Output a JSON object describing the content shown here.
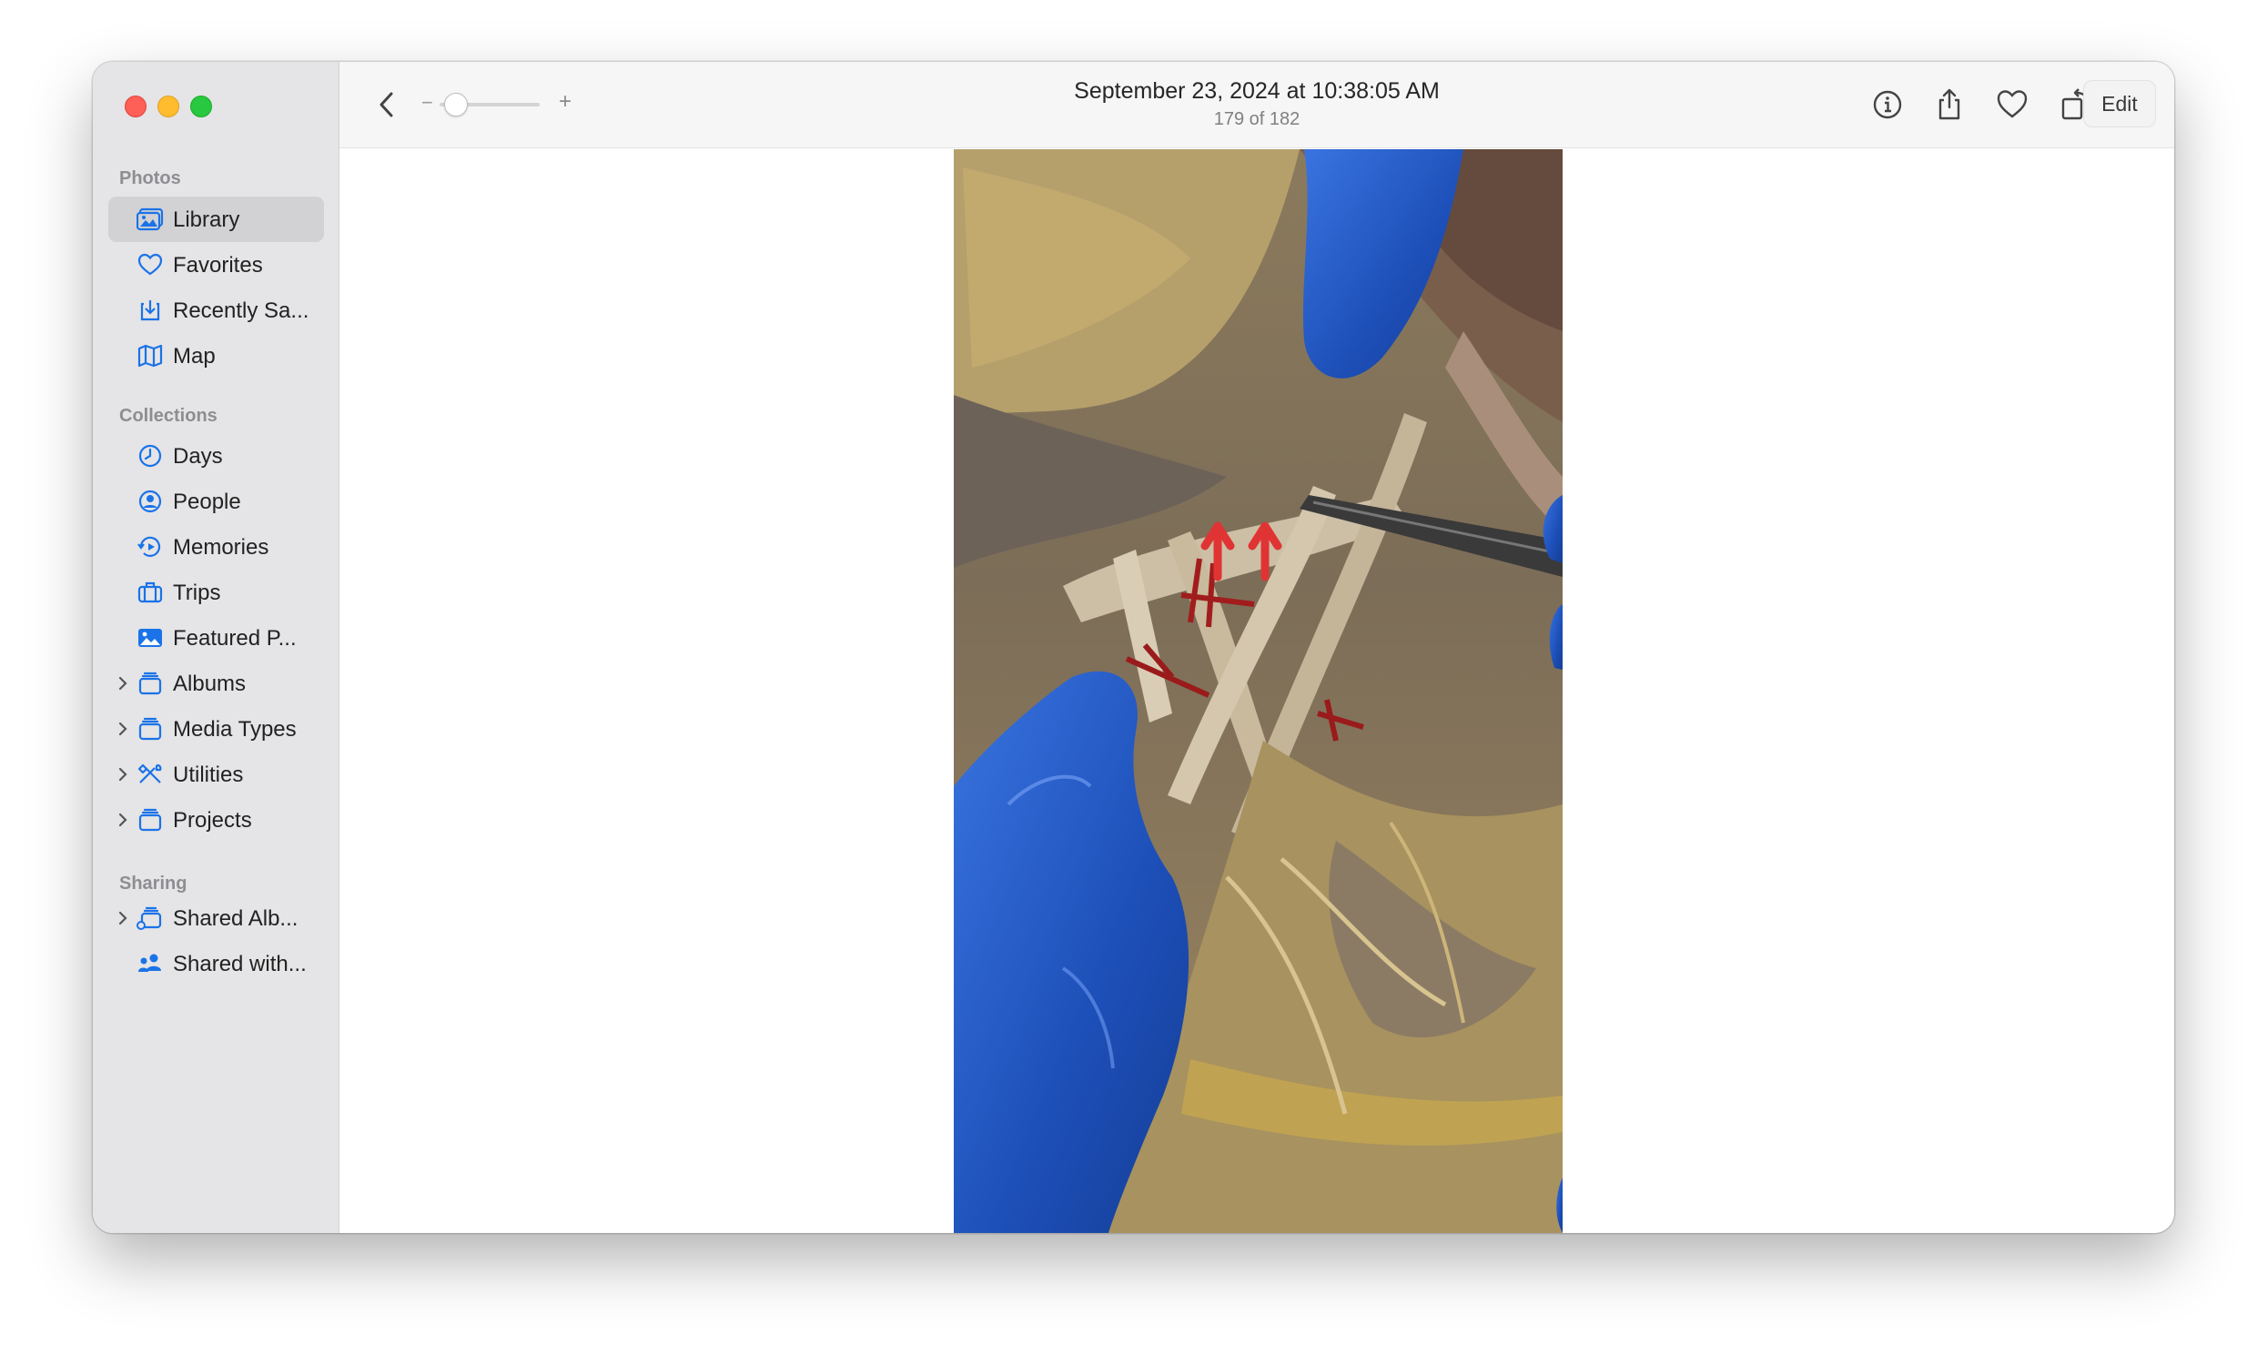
{
  "window": {
    "traffic_lights": {
      "close": "#fe5f57",
      "minimize": "#febc2e",
      "zoom": "#28c840"
    }
  },
  "sidebar": {
    "accent_color": "#1a73e8",
    "sections": [
      {
        "label": "Photos",
        "items": [
          {
            "label": "Library",
            "icon": "library-icon",
            "selected": true
          },
          {
            "label": "Favorites",
            "icon": "heart-icon"
          },
          {
            "label": "Recently Sa...",
            "icon": "recently-saved-icon"
          },
          {
            "label": "Map",
            "icon": "map-icon"
          }
        ]
      },
      {
        "label": "Collections",
        "items": [
          {
            "label": "Days",
            "icon": "clock-icon"
          },
          {
            "label": "People",
            "icon": "person-icon"
          },
          {
            "label": "Memories",
            "icon": "memories-icon"
          },
          {
            "label": "Trips",
            "icon": "suitcase-icon"
          },
          {
            "label": "Featured P...",
            "icon": "photo-icon"
          },
          {
            "label": "Albums",
            "icon": "folder-icon",
            "expandable": true
          },
          {
            "label": "Media Types",
            "icon": "folder-icon",
            "expandable": true
          },
          {
            "label": "Utilities",
            "icon": "tools-icon",
            "expandable": true
          },
          {
            "label": "Projects",
            "icon": "folder-icon",
            "expandable": true
          }
        ]
      },
      {
        "label": "Sharing",
        "items": [
          {
            "label": "Shared Alb...",
            "icon": "shared-album-icon",
            "expandable": true
          },
          {
            "label": "Shared with...",
            "icon": "shared-with-icon"
          }
        ]
      }
    ]
  },
  "toolbar": {
    "title": "September 23, 2024 at 10:38:05 AM",
    "subtitle": "179 of 182",
    "zoom_minus": "−",
    "zoom_plus": "+",
    "edit_label": "Edit",
    "icons": [
      "info-icon",
      "share-icon",
      "heart-icon",
      "rotate-icon",
      "magic-wand-icon"
    ]
  },
  "photo": {
    "subject": "anatomical dissection photo"
  }
}
